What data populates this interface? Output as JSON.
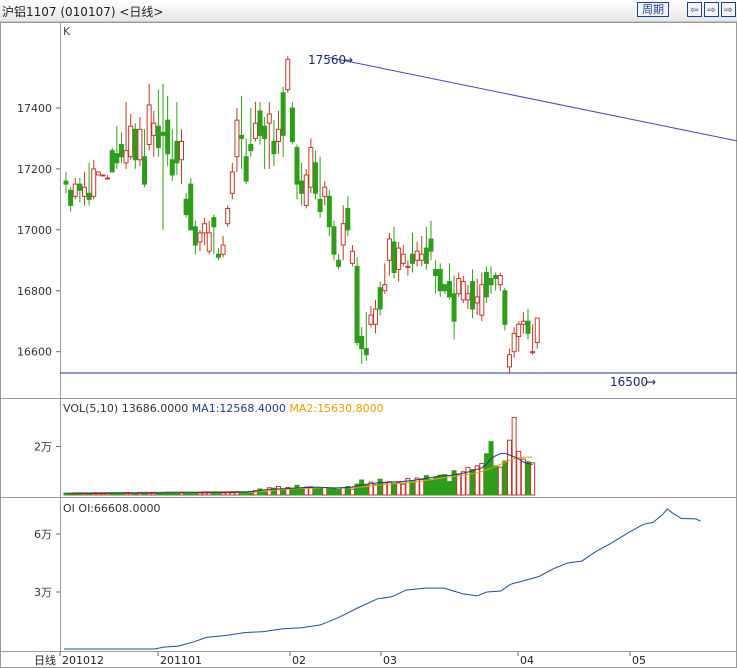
{
  "header": {
    "title": "沪铝1107 (010107) <日线>",
    "period_button": "周期",
    "nav_prev": "⇦",
    "nav_window": "⇨",
    "nav_next": "⇨"
  },
  "colors": {
    "up": "#c0392b",
    "down": "#2e9e1a",
    "ma1": "#1f3f7f",
    "ma2": "#e8a000",
    "trendline": "#5a3ab8",
    "support": "#1f3f7f",
    "oi": "#1f4f8f"
  },
  "chart_data": [
    {
      "type": "candlestick",
      "panel_label": "K",
      "ylim": [
        16530,
        17610
      ],
      "y_ticks": [
        16600,
        16800,
        17000,
        17200,
        17400
      ],
      "annotations": [
        {
          "text": "17560",
          "value": 17560
        },
        {
          "text": "16500",
          "value": 16500
        }
      ],
      "trendline": {
        "from": 17560,
        "to": 17200
      },
      "support_line": 16530,
      "candles": [
        [
          17160,
          17150,
          17190,
          17120
        ],
        [
          17130,
          17080,
          17140,
          17060
        ],
        [
          17110,
          17150,
          17170,
          17100
        ],
        [
          17150,
          17130,
          17170,
          17090
        ],
        [
          17110,
          17140,
          17190,
          17080
        ],
        [
          17120,
          17100,
          17220,
          17080
        ],
        [
          17110,
          17200,
          17230,
          17100
        ],
        [
          17180,
          17190,
          17190,
          17180
        ],
        [
          17180,
          17180,
          17180,
          17180
        ],
        [
          17170,
          17170,
          17180,
          17170
        ],
        [
          17260,
          17190,
          17270,
          17190
        ],
        [
          17250,
          17220,
          17340,
          17200
        ],
        [
          17280,
          17240,
          17320,
          17220
        ],
        [
          17220,
          17260,
          17420,
          17200
        ],
        [
          17240,
          17340,
          17380,
          17230
        ],
        [
          17330,
          17230,
          17350,
          17200
        ],
        [
          17230,
          17330,
          17370,
          17210
        ],
        [
          17240,
          17150,
          17330,
          17140
        ],
        [
          17280,
          17410,
          17480,
          17260
        ],
        [
          17310,
          17350,
          17390,
          17240
        ],
        [
          17340,
          17270,
          17460,
          17240
        ],
        [
          17320,
          17310,
          17480,
          17000
        ],
        [
          17360,
          17250,
          17440,
          17210
        ],
        [
          17230,
          17180,
          17330,
          17160
        ],
        [
          17290,
          17220,
          17420,
          17180
        ],
        [
          17230,
          17290,
          17330,
          17150
        ],
        [
          17100,
          17050,
          17120,
          17040
        ],
        [
          17150,
          17000,
          17170,
          17000
        ],
        [
          17010,
          16950,
          17030,
          16920
        ],
        [
          16960,
          16990,
          17000,
          16930
        ],
        [
          16990,
          17020,
          17040,
          16950
        ],
        [
          16930,
          16990,
          17030,
          16920
        ],
        [
          17040,
          17010,
          17050,
          16920
        ],
        [
          16920,
          16910,
          16940,
          16900
        ],
        [
          16920,
          16950,
          16980,
          16910
        ],
        [
          17020,
          17070,
          17080,
          17010
        ],
        [
          17120,
          17190,
          17220,
          17100
        ],
        [
          17240,
          17360,
          17400,
          17190
        ],
        [
          17310,
          17300,
          17440,
          17200
        ],
        [
          17240,
          17160,
          17300,
          17150
        ],
        [
          17280,
          17260,
          17400,
          17240
        ],
        [
          17300,
          17350,
          17420,
          17290
        ],
        [
          17390,
          17310,
          17420,
          17280
        ],
        [
          17340,
          17300,
          17370,
          17200
        ],
        [
          17350,
          17380,
          17420,
          17200
        ],
        [
          17290,
          17250,
          17360,
          17210
        ],
        [
          17290,
          17330,
          17390,
          17250
        ],
        [
          17450,
          17310,
          17470,
          17240
        ],
        [
          17460,
          17560,
          17570,
          17450
        ],
        [
          17400,
          17290,
          17420,
          17280
        ],
        [
          17270,
          17150,
          17280,
          17100
        ],
        [
          17160,
          17120,
          17220,
          17080
        ],
        [
          17080,
          17180,
          17200,
          17070
        ],
        [
          17140,
          17270,
          17300,
          17120
        ],
        [
          17220,
          17120,
          17260,
          17100
        ],
        [
          17100,
          17060,
          17240,
          17040
        ],
        [
          17110,
          17140,
          17160,
          17080
        ],
        [
          17110,
          17010,
          17130,
          16980
        ],
        [
          17010,
          16920,
          17030,
          16900
        ],
        [
          16900,
          16880,
          16920,
          16870
        ],
        [
          16950,
          17020,
          17080,
          16900
        ],
        [
          17070,
          17000,
          17110,
          16980
        ],
        [
          16890,
          16930,
          16950,
          16880
        ],
        [
          16880,
          16630,
          16910,
          16620
        ],
        [
          16650,
          16610,
          16680,
          16560
        ],
        [
          16610,
          16590,
          16730,
          16570
        ],
        [
          16690,
          16720,
          16750,
          16680
        ],
        [
          16690,
          16740,
          16770,
          16660
        ],
        [
          16810,
          16740,
          16830,
          16720
        ],
        [
          16800,
          16820,
          16890,
          16790
        ],
        [
          16900,
          16970,
          16990,
          16850
        ],
        [
          16960,
          16860,
          17010,
          16840
        ],
        [
          16870,
          16940,
          16960,
          16830
        ],
        [
          16890,
          16920,
          16950,
          16880
        ],
        [
          16880,
          16880,
          16900,
          16850
        ],
        [
          16920,
          16890,
          16990,
          16860
        ],
        [
          16900,
          16930,
          16960,
          16880
        ],
        [
          16900,
          16920,
          16980,
          16880
        ],
        [
          16940,
          16890,
          17010,
          16870
        ],
        [
          16970,
          16930,
          17030,
          16900
        ],
        [
          16870,
          16850,
          16900,
          16790
        ],
        [
          16870,
          16800,
          16890,
          16780
        ],
        [
          16820,
          16800,
          16820,
          16790
        ],
        [
          16830,
          16780,
          16890,
          16770
        ],
        [
          16790,
          16700,
          16850,
          16640
        ],
        [
          16790,
          16840,
          16860,
          16780
        ],
        [
          16770,
          16830,
          16850,
          16760
        ],
        [
          16770,
          16790,
          16820,
          16740
        ],
        [
          16830,
          16740,
          16870,
          16710
        ],
        [
          16760,
          16780,
          16840,
          16720
        ],
        [
          16720,
          16820,
          16860,
          16700
        ],
        [
          16860,
          16780,
          16880,
          16760
        ],
        [
          16840,
          16820,
          16880,
          16790
        ],
        [
          16850,
          16840,
          16860,
          16800
        ],
        [
          16820,
          16850,
          16860,
          16800
        ],
        [
          16800,
          16690,
          16810,
          16670
        ],
        [
          16550,
          16590,
          16610,
          16530
        ],
        [
          16600,
          16660,
          16680,
          16580
        ],
        [
          16650,
          16690,
          16700,
          16600
        ],
        [
          16690,
          16700,
          16730,
          16660
        ],
        [
          16700,
          16660,
          16740,
          16640
        ],
        [
          16600,
          16600,
          16690,
          16590
        ],
        [
          16630,
          16710,
          16710,
          16610
        ]
      ]
    },
    {
      "type": "bar",
      "panel_label": "VOL(5,10)",
      "volume_value": "13686.0000",
      "ma1_label": "MA1:12568.4000",
      "ma2_label": "MA2:15630.8000",
      "ylim": [
        0,
        33000
      ],
      "y_ticks": [
        20000
      ],
      "y_tick_labels": [
        "2万"
      ],
      "volumes": [
        800,
        800,
        900,
        900,
        900,
        900,
        950,
        950,
        950,
        950,
        1000,
        1000,
        1000,
        1000,
        1000,
        1000,
        1100,
        1100,
        1100,
        1100,
        1100,
        1100,
        1200,
        1200,
        1200,
        1200,
        1200,
        1200,
        1200,
        1200,
        1300,
        1300,
        1300,
        1300,
        1300,
        1300,
        1400,
        1400,
        1400,
        1400,
        1500,
        1800,
        2500,
        1600,
        3000,
        2800,
        3500,
        2500,
        3100,
        2800,
        4000,
        2400,
        3300,
        3400,
        3100,
        3000,
        3100,
        2800,
        2600,
        2300,
        3100,
        3500,
        2400,
        4500,
        6200,
        4000,
        5300,
        4200,
        6500,
        5000,
        5500,
        4800,
        5100,
        4500,
        6800,
        5500,
        7000,
        6400,
        8000,
        6500,
        7400,
        8200,
        8400,
        5500,
        10000,
        8700,
        9600,
        11400,
        10500,
        12000,
        13000,
        17000,
        22000,
        12000,
        11500,
        14000,
        22600,
        32000,
        18000,
        14800,
        13700,
        13300
      ],
      "ma1": [
        500,
        520,
        550,
        580,
        600,
        600,
        620,
        650,
        650,
        680,
        700,
        700,
        720,
        720,
        740,
        750,
        760,
        780,
        780,
        800,
        800,
        810,
        820,
        840,
        850,
        860,
        870,
        880,
        900,
        900,
        920,
        940,
        960,
        980,
        1000,
        1000,
        1050,
        1100,
        1150,
        1200,
        1400,
        1600,
        1900,
        2100,
        2300,
        2400,
        2500,
        2600,
        2700,
        2800,
        2900,
        3000,
        3100,
        3100,
        3200,
        3200,
        3100,
        3000,
        2900,
        2900,
        3000,
        3100,
        3300,
        3700,
        4100,
        4400,
        4600,
        4900,
        5100,
        5200,
        5300,
        5400,
        5500,
        5600,
        5800,
        6000,
        6300,
        6600,
        6900,
        7200,
        7500,
        7800,
        8000,
        8100,
        8300,
        8600,
        9000,
        9500,
        10000,
        10600,
        11200,
        12500,
        15000,
        16200,
        17000,
        17200,
        16500,
        15800,
        14800,
        13600,
        13000,
        12568
      ],
      "ma2": [
        450,
        460,
        470,
        480,
        500,
        510,
        520,
        530,
        540,
        550,
        560,
        570,
        580,
        590,
        600,
        610,
        620,
        630,
        640,
        650,
        660,
        670,
        680,
        690,
        700,
        710,
        720,
        730,
        740,
        750,
        760,
        770,
        780,
        790,
        800,
        810,
        830,
        860,
        890,
        920,
        1000,
        1150,
        1350,
        1550,
        1750,
        1950,
        2100,
        2250,
        2400,
        2500,
        2600,
        2700,
        2800,
        2850,
        2900,
        2950,
        3000,
        3000,
        3000,
        3000,
        3000,
        3000,
        3050,
        3150,
        3300,
        3500,
        3700,
        3900,
        4100,
        4300,
        4500,
        4650,
        4800,
        4950,
        5100,
        5300,
        5500,
        5750,
        6000,
        6300,
        6600,
        6900,
        7200,
        7450,
        7700,
        7950,
        8200,
        8500,
        8800,
        9200,
        9700,
        10300,
        11000,
        11800,
        12600,
        13500,
        14300,
        15000,
        15400,
        15600,
        15650,
        15630
      ]
    },
    {
      "type": "line",
      "panel_label": "OI",
      "oi_label": "OI:66608.0000",
      "ylim": [
        0,
        75000
      ],
      "y_ticks": [
        30000,
        60000
      ],
      "y_tick_labels": [
        "3万",
        "6万"
      ],
      "period_label": "日线",
      "x_labels": [
        {
          "text": "201012",
          "index": 0
        },
        {
          "text": "201101",
          "index": 21
        },
        {
          "text": "02",
          "index": 49
        },
        {
          "text": "03",
          "index": 66
        },
        {
          "text": "04",
          "index": 92
        },
        {
          "text": "05",
          "index": 114
        }
      ],
      "oi_points": [
        [
          0,
          500
        ],
        [
          19,
          500
        ],
        [
          21,
          1500
        ],
        [
          24,
          2000
        ],
        [
          27,
          4000
        ],
        [
          30,
          6500
        ],
        [
          34,
          7500
        ],
        [
          38,
          9000
        ],
        [
          42,
          9500
        ],
        [
          46,
          11000
        ],
        [
          50,
          11500
        ],
        [
          54,
          13000
        ],
        [
          58,
          17000
        ],
        [
          62,
          22000
        ],
        [
          66,
          26500
        ],
        [
          69,
          27500
        ],
        [
          72,
          31000
        ],
        [
          76,
          32000
        ],
        [
          80,
          32000
        ],
        [
          84,
          29000
        ],
        [
          87,
          28000
        ],
        [
          89,
          30000
        ],
        [
          92,
          30500
        ],
        [
          94,
          34000
        ],
        [
          97,
          36000
        ],
        [
          100,
          38000
        ],
        [
          103,
          42000
        ],
        [
          106,
          45000
        ],
        [
          109,
          46000
        ],
        [
          112,
          51000
        ],
        [
          115,
          55000
        ],
        [
          117,
          58000
        ],
        [
          119,
          61000
        ],
        [
          122,
          65000
        ],
        [
          124,
          66000
        ],
        [
          126,
          70000
        ],
        [
          127,
          73000
        ],
        [
          128,
          71000
        ],
        [
          130,
          68000
        ],
        [
          133,
          67800
        ],
        [
          134,
          66608
        ]
      ],
      "x_index_max": 136
    }
  ]
}
